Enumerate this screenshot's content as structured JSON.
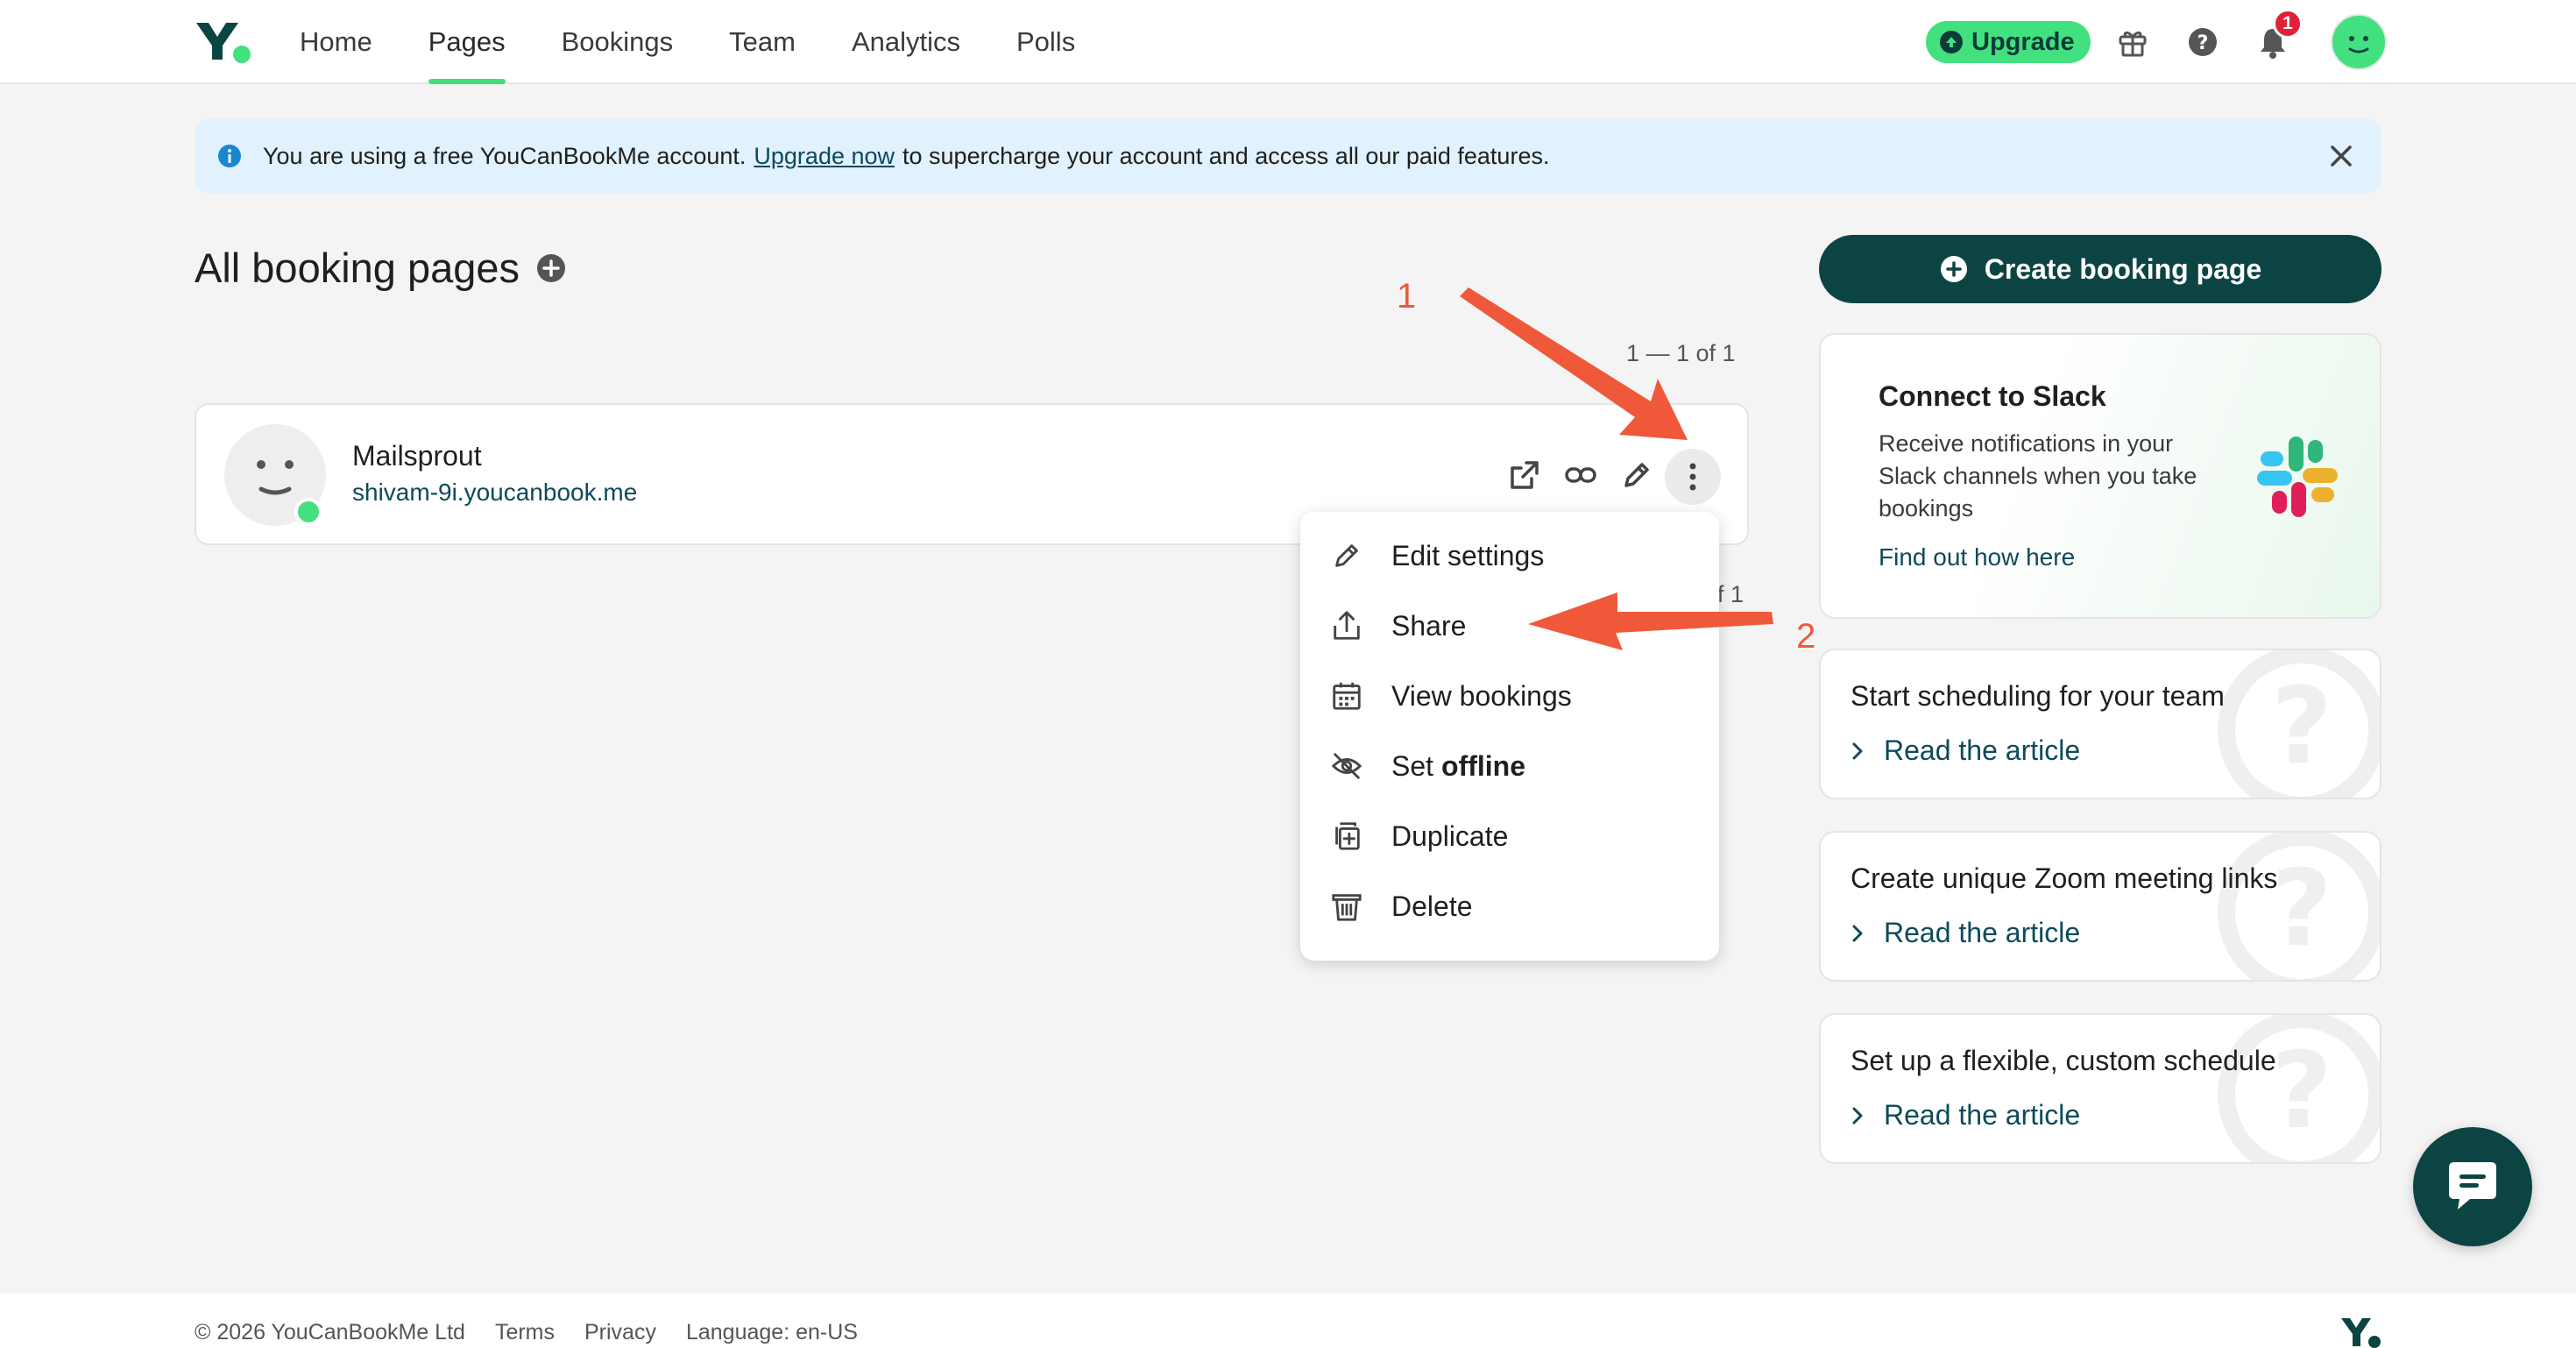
{
  "header": {
    "nav": [
      {
        "label": "Home",
        "active": false
      },
      {
        "label": "Pages",
        "active": true
      },
      {
        "label": "Bookings",
        "active": false
      },
      {
        "label": "Team",
        "active": false
      },
      {
        "label": "Analytics",
        "active": false
      },
      {
        "label": "Polls",
        "active": false
      }
    ],
    "upgrade_label": "Upgrade",
    "notification_count": "1",
    "icons": [
      "gift-icon",
      "help-icon",
      "bell-icon",
      "user-avatar"
    ]
  },
  "banner": {
    "text_before": "You are using a free YouCanBookMe account.",
    "link": "Upgrade now",
    "text_after": "to supercharge your account and access all our paid features."
  },
  "main": {
    "title": "All booking pages",
    "count_top": "1 — 1 of 1",
    "count_bottom": "f 1",
    "booking_page": {
      "name": "Mailsprout",
      "url": "shivam-9i.youcanbook.me",
      "status": "online"
    }
  },
  "menu": {
    "items": [
      {
        "label": "Edit settings",
        "icon": "pencil-icon"
      },
      {
        "label": "Share",
        "icon": "share-icon"
      },
      {
        "label": "View bookings",
        "icon": "calendar-icon"
      },
      {
        "label_prefix": "Set",
        "label_bold": "offline",
        "icon": "eye-off-icon"
      },
      {
        "label": "Duplicate",
        "icon": "duplicate-icon"
      },
      {
        "label": "Delete",
        "icon": "trash-icon"
      }
    ]
  },
  "annotations": {
    "step1": "1",
    "step2": "2",
    "color": "#f0583a"
  },
  "sidebar": {
    "create_label": "Create booking page",
    "slack": {
      "title": "Connect to Slack",
      "description": "Receive notifications in your Slack channels when you take bookings",
      "link": "Find out how here"
    },
    "articles": [
      {
        "title": "Start scheduling for your team",
        "link": "Read the article"
      },
      {
        "title": "Create unique Zoom meeting links",
        "link": "Read the article"
      },
      {
        "title": "Set up a flexible, custom schedule",
        "link": "Read the article"
      }
    ]
  },
  "footer": {
    "copyright": "© 2026 YouCanBookMe Ltd",
    "terms": "Terms",
    "privacy": "Privacy",
    "language": "Language: en-US"
  },
  "colors": {
    "brand_dark": "#0c4444",
    "brand_green": "#43e07f",
    "banner_bg": "#e1f1fd"
  }
}
